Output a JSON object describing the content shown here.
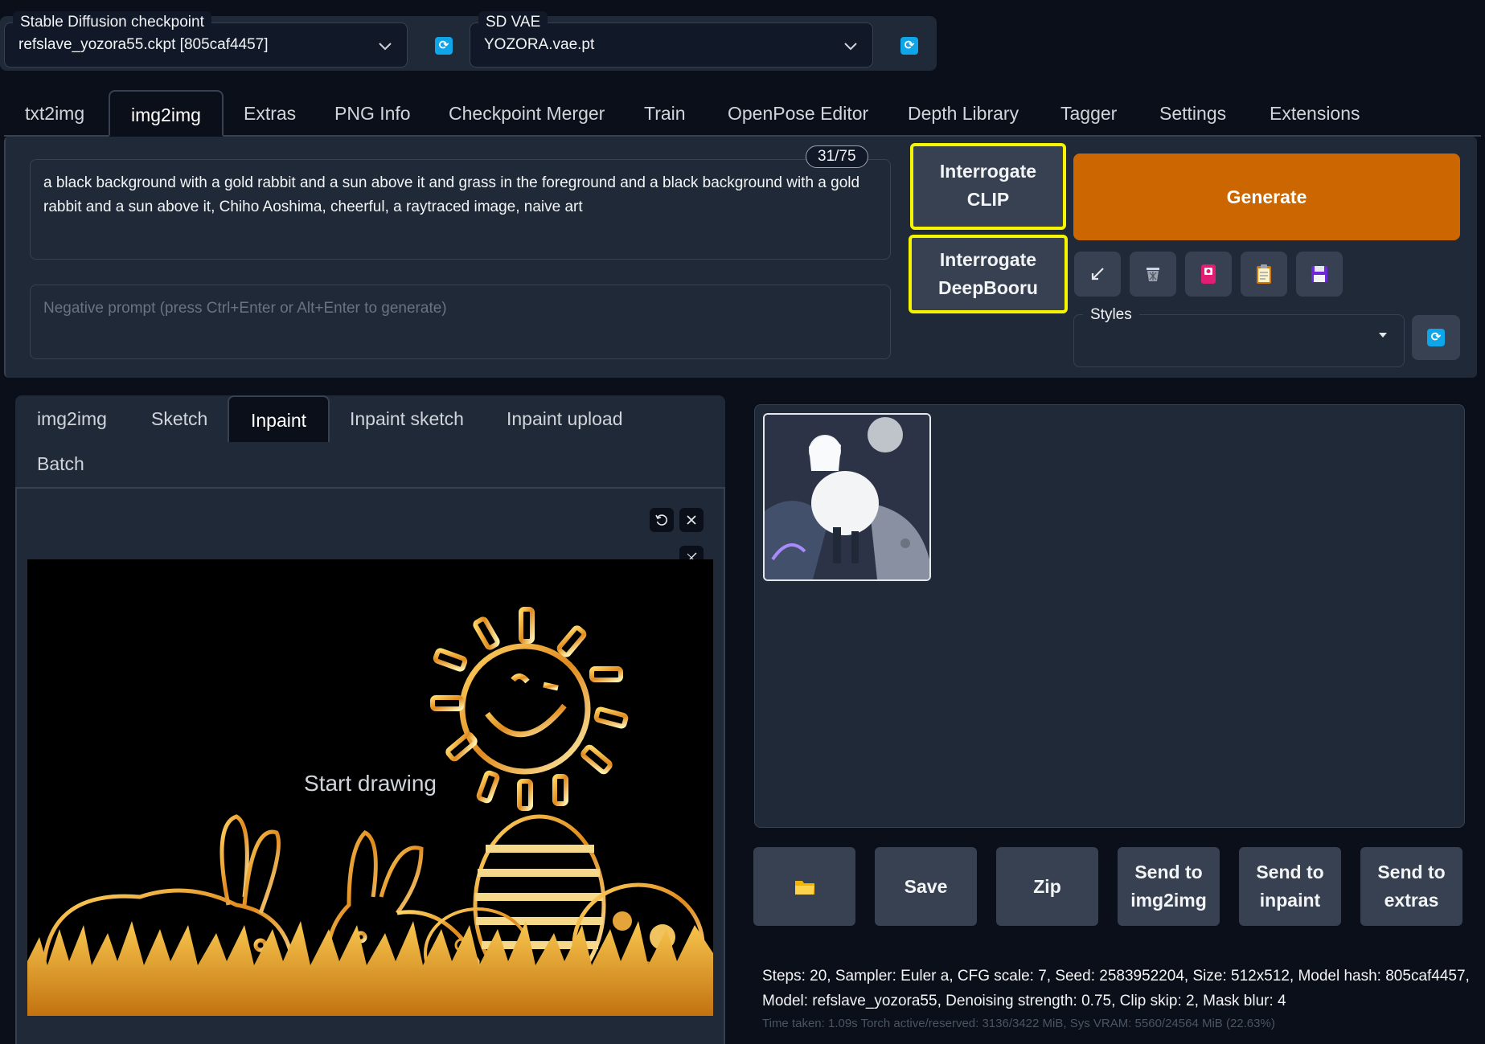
{
  "top": {
    "checkpoint_label": "Stable Diffusion checkpoint",
    "checkpoint_value": "refslave_yozora55.ckpt [805caf4457]",
    "vae_label": "SD VAE",
    "vae_value": "YOZORA.vae.pt"
  },
  "tabs": [
    "txt2img",
    "img2img",
    "Extras",
    "PNG Info",
    "Checkpoint Merger",
    "Train",
    "OpenPose Editor",
    "Depth Library",
    "Tagger",
    "Settings",
    "Extensions"
  ],
  "active_tab": "img2img",
  "prompt": {
    "text": "a black background with a gold rabbit and a sun above it and grass in the foreground and a black background with a gold rabbit and a sun above it, Chiho Aoshima, cheerful, a raytraced image, naive art",
    "token_count": "31/75",
    "negative_placeholder": "Negative prompt (press Ctrl+Enter or Alt+Enter to generate)"
  },
  "actions": {
    "interrogate_clip_line1": "Interrogate",
    "interrogate_clip_line2": "CLIP",
    "interrogate_deepbooru_line1": "Interrogate",
    "interrogate_deepbooru_line2": "DeepBooru",
    "generate": "Generate",
    "styles_label": "Styles",
    "highlight_color": "#f5f500",
    "generate_color": "#cc6600"
  },
  "tool_icons": [
    "arrow-icon",
    "trash-icon",
    "pink-card-icon",
    "clipboard-icon",
    "save-disk-icon"
  ],
  "subtabs": [
    "img2img",
    "Sketch",
    "Inpaint",
    "Inpaint sketch",
    "Inpaint upload",
    "Batch"
  ],
  "active_subtab": "Inpaint",
  "canvas": {
    "placeholder": "Start drawing"
  },
  "output_buttons": {
    "folder_icon": "folder-icon",
    "save": "Save",
    "zip": "Zip",
    "send_img2img_line1": "Send to",
    "send_img2img_line2": "img2img",
    "send_inpaint_line1": "Send to",
    "send_inpaint_line2": "inpaint",
    "send_extras_line1": "Send to",
    "send_extras_line2": "extras"
  },
  "generation_info": "Steps: 20, Sampler: Euler a, CFG scale: 7, Seed: 2583952204, Size: 512x512, Model hash: 805caf4457, Model: refslave_yozora55, Denoising strength: 0.75, Clip skip: 2, Mask blur: 4",
  "perf_info": "Time taken: 1.09s  Torch active/reserved: 3136/3422 MiB, Sys VRAM: 5560/24564 MiB (22.63%)"
}
